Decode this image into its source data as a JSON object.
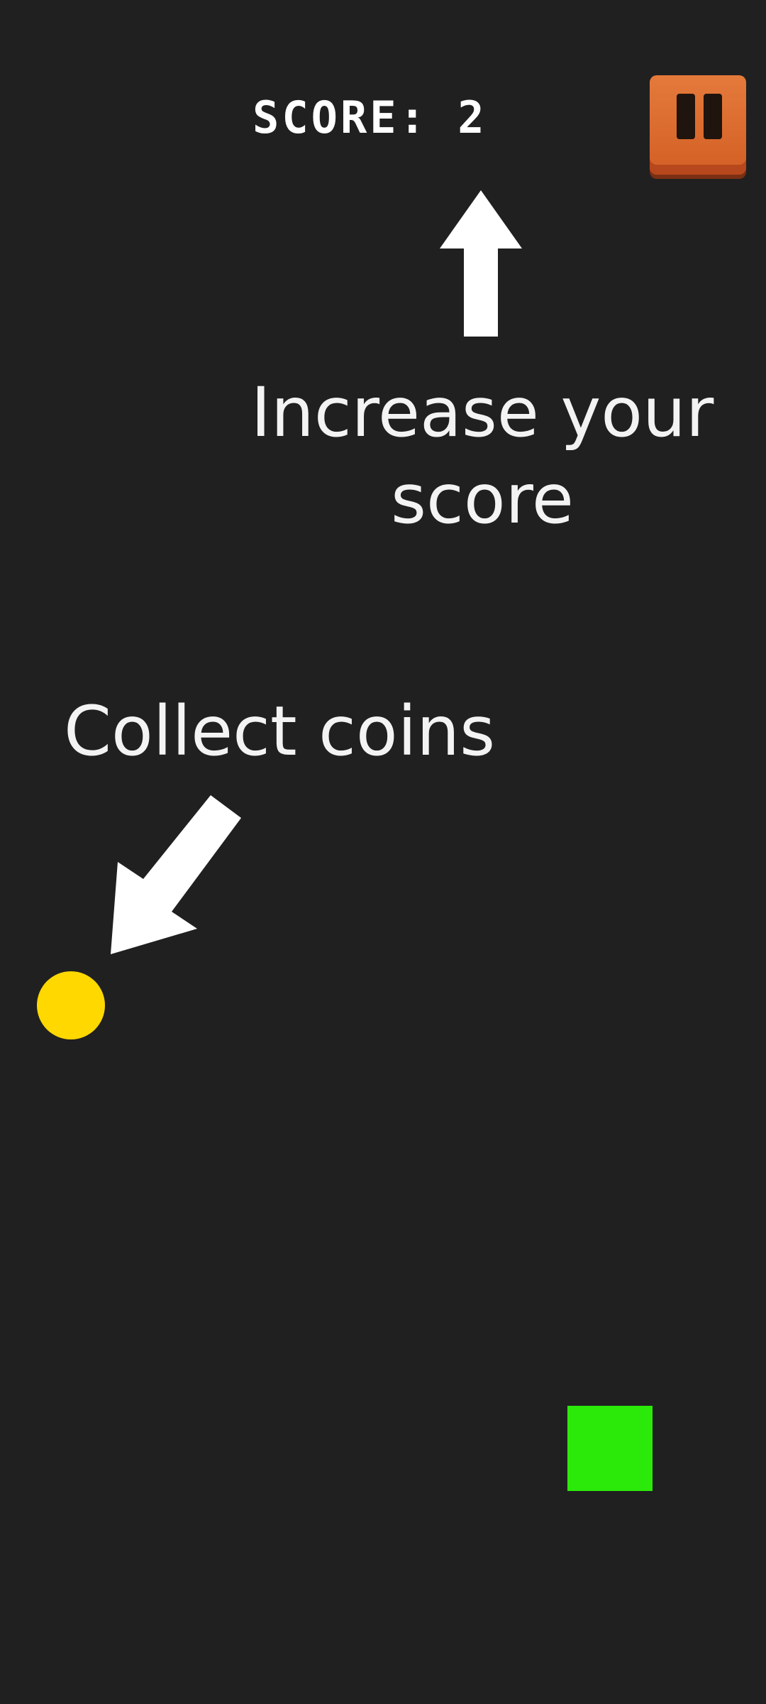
{
  "hud": {
    "score_text": "SCORE: 2",
    "pause_icon": "pause-icon"
  },
  "tutorial": {
    "score_hint": "Increase your score",
    "coins_hint": "Collect coins"
  },
  "colors": {
    "background": "#202020",
    "coin": "#FFD800",
    "player": "#2BEA0A",
    "pause_button": "#D9652A",
    "text": "#F3F3F3"
  }
}
